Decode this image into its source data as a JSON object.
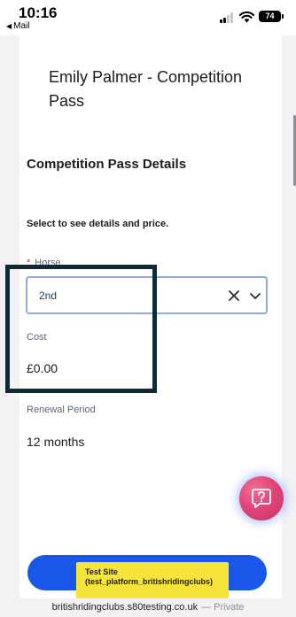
{
  "status_bar": {
    "time": "10:16",
    "back_app": "Mail",
    "battery": "74"
  },
  "card": {
    "title": "Emily Palmer - Competition Pass",
    "section_title": "Competition Pass Details",
    "instruction": "Select to see details and price."
  },
  "horse": {
    "required_mark": "*",
    "label": "Horse",
    "selected": "2nd"
  },
  "cost": {
    "label": "Cost",
    "value": "£0.00"
  },
  "renewal": {
    "label": "Renewal Period",
    "value": "12 months"
  },
  "test_badge": {
    "line1": "Test Site",
    "line2": "(test_platform_britishridingclubs)"
  },
  "url_bar": {
    "domain": "britishridingclubs.s80testing.co.uk",
    "suffix": "— Private"
  },
  "colors": {
    "primary_button": "#1a56e8",
    "select_border": "#8ea9e6",
    "highlight_box": "#0f2a36",
    "help_button": "#e0457a",
    "test_badge": "#f7e43a",
    "required": "#d9304e"
  },
  "icons": [
    "signal-icon",
    "wifi-icon",
    "clear-icon",
    "chevron-down-icon",
    "help-icon"
  ]
}
